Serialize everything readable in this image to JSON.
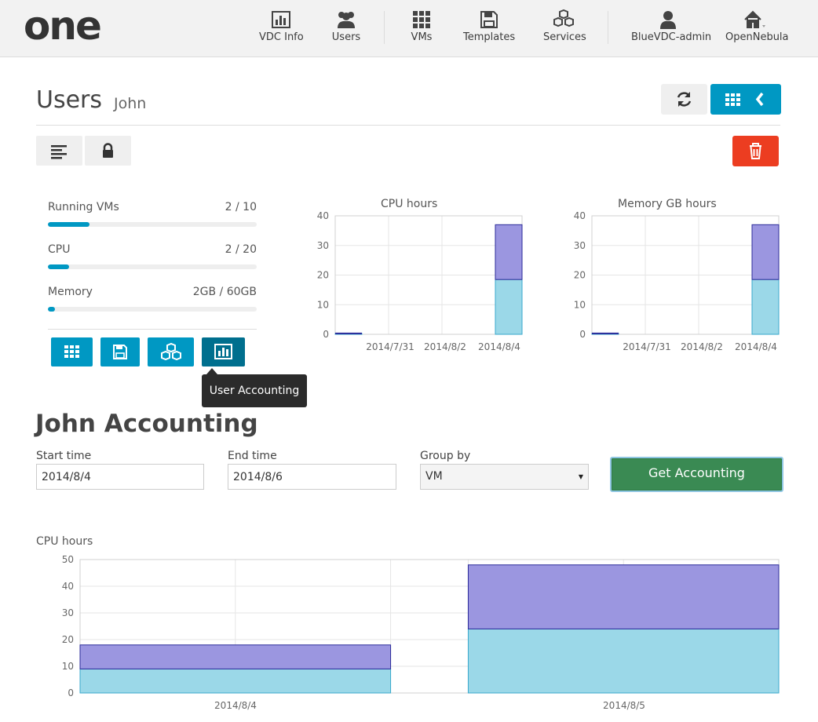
{
  "colors": {
    "accent": "#0098c3",
    "danger": "#ec3d21",
    "success": "#3a8a53",
    "series_total": "#9b96e0",
    "series_base": "#9bd8e8",
    "tooltip_bg": "#2b2b2b"
  },
  "nav": {
    "logo_text": "one",
    "items": [
      {
        "label": "VDC Info",
        "icon": "bar-chart-icon"
      },
      {
        "label": "Users",
        "icon": "users-icon"
      },
      {
        "label": "VMs",
        "icon": "grid-icon"
      },
      {
        "label": "Templates",
        "icon": "save-icon"
      },
      {
        "label": "Services",
        "icon": "cubes-icon"
      },
      {
        "label": "BlueVDC-admin",
        "icon": "user-icon"
      },
      {
        "label": "OpenNebula",
        "icon": "home-icon"
      }
    ]
  },
  "header": {
    "title": "Users",
    "subtitle": "John"
  },
  "quotas": [
    {
      "label": "Running VMs",
      "value": "2 / 10",
      "fraction": 0.2
    },
    {
      "label": "CPU",
      "value": "2 / 20",
      "fraction": 0.1
    },
    {
      "label": "Memory",
      "value": "2GB / 60GB",
      "fraction": 0.033
    }
  ],
  "tooltip": "User Accounting",
  "accounting": {
    "title": "John Accounting",
    "start_label": "Start time",
    "start_value": "2014/8/4",
    "end_label": "End time",
    "end_value": "2014/8/6",
    "group_label": "Group by",
    "group_value": "VM",
    "button": "Get Accounting"
  },
  "chart_data": [
    {
      "type": "bar",
      "title": "CPU hours",
      "categories": [
        "2014/7/31",
        "2014/8/2",
        "2014/8/4"
      ],
      "ylim": [
        0,
        40
      ],
      "yticks": [
        0,
        10,
        20,
        30,
        40
      ],
      "series": [
        {
          "values": [
            0.3,
            0,
            18.5
          ]
        },
        {
          "values": [
            0,
            0,
            18.5
          ]
        }
      ]
    },
    {
      "type": "bar",
      "title": "Memory GB hours",
      "categories": [
        "2014/7/31",
        "2014/8/2",
        "2014/8/4"
      ],
      "ylim": [
        0,
        40
      ],
      "yticks": [
        0,
        10,
        20,
        30,
        40
      ],
      "series": [
        {
          "values": [
            0.3,
            0,
            18.5
          ]
        },
        {
          "values": [
            0,
            0,
            18.5
          ]
        }
      ]
    },
    {
      "type": "bar",
      "title": "CPU hours",
      "categories": [
        "2014/8/4",
        "2014/8/5"
      ],
      "ylim": [
        0,
        50
      ],
      "yticks": [
        0,
        10,
        20,
        30,
        40,
        50
      ],
      "series": [
        {
          "values": [
            9,
            24
          ]
        },
        {
          "values": [
            9,
            24
          ]
        }
      ]
    }
  ]
}
